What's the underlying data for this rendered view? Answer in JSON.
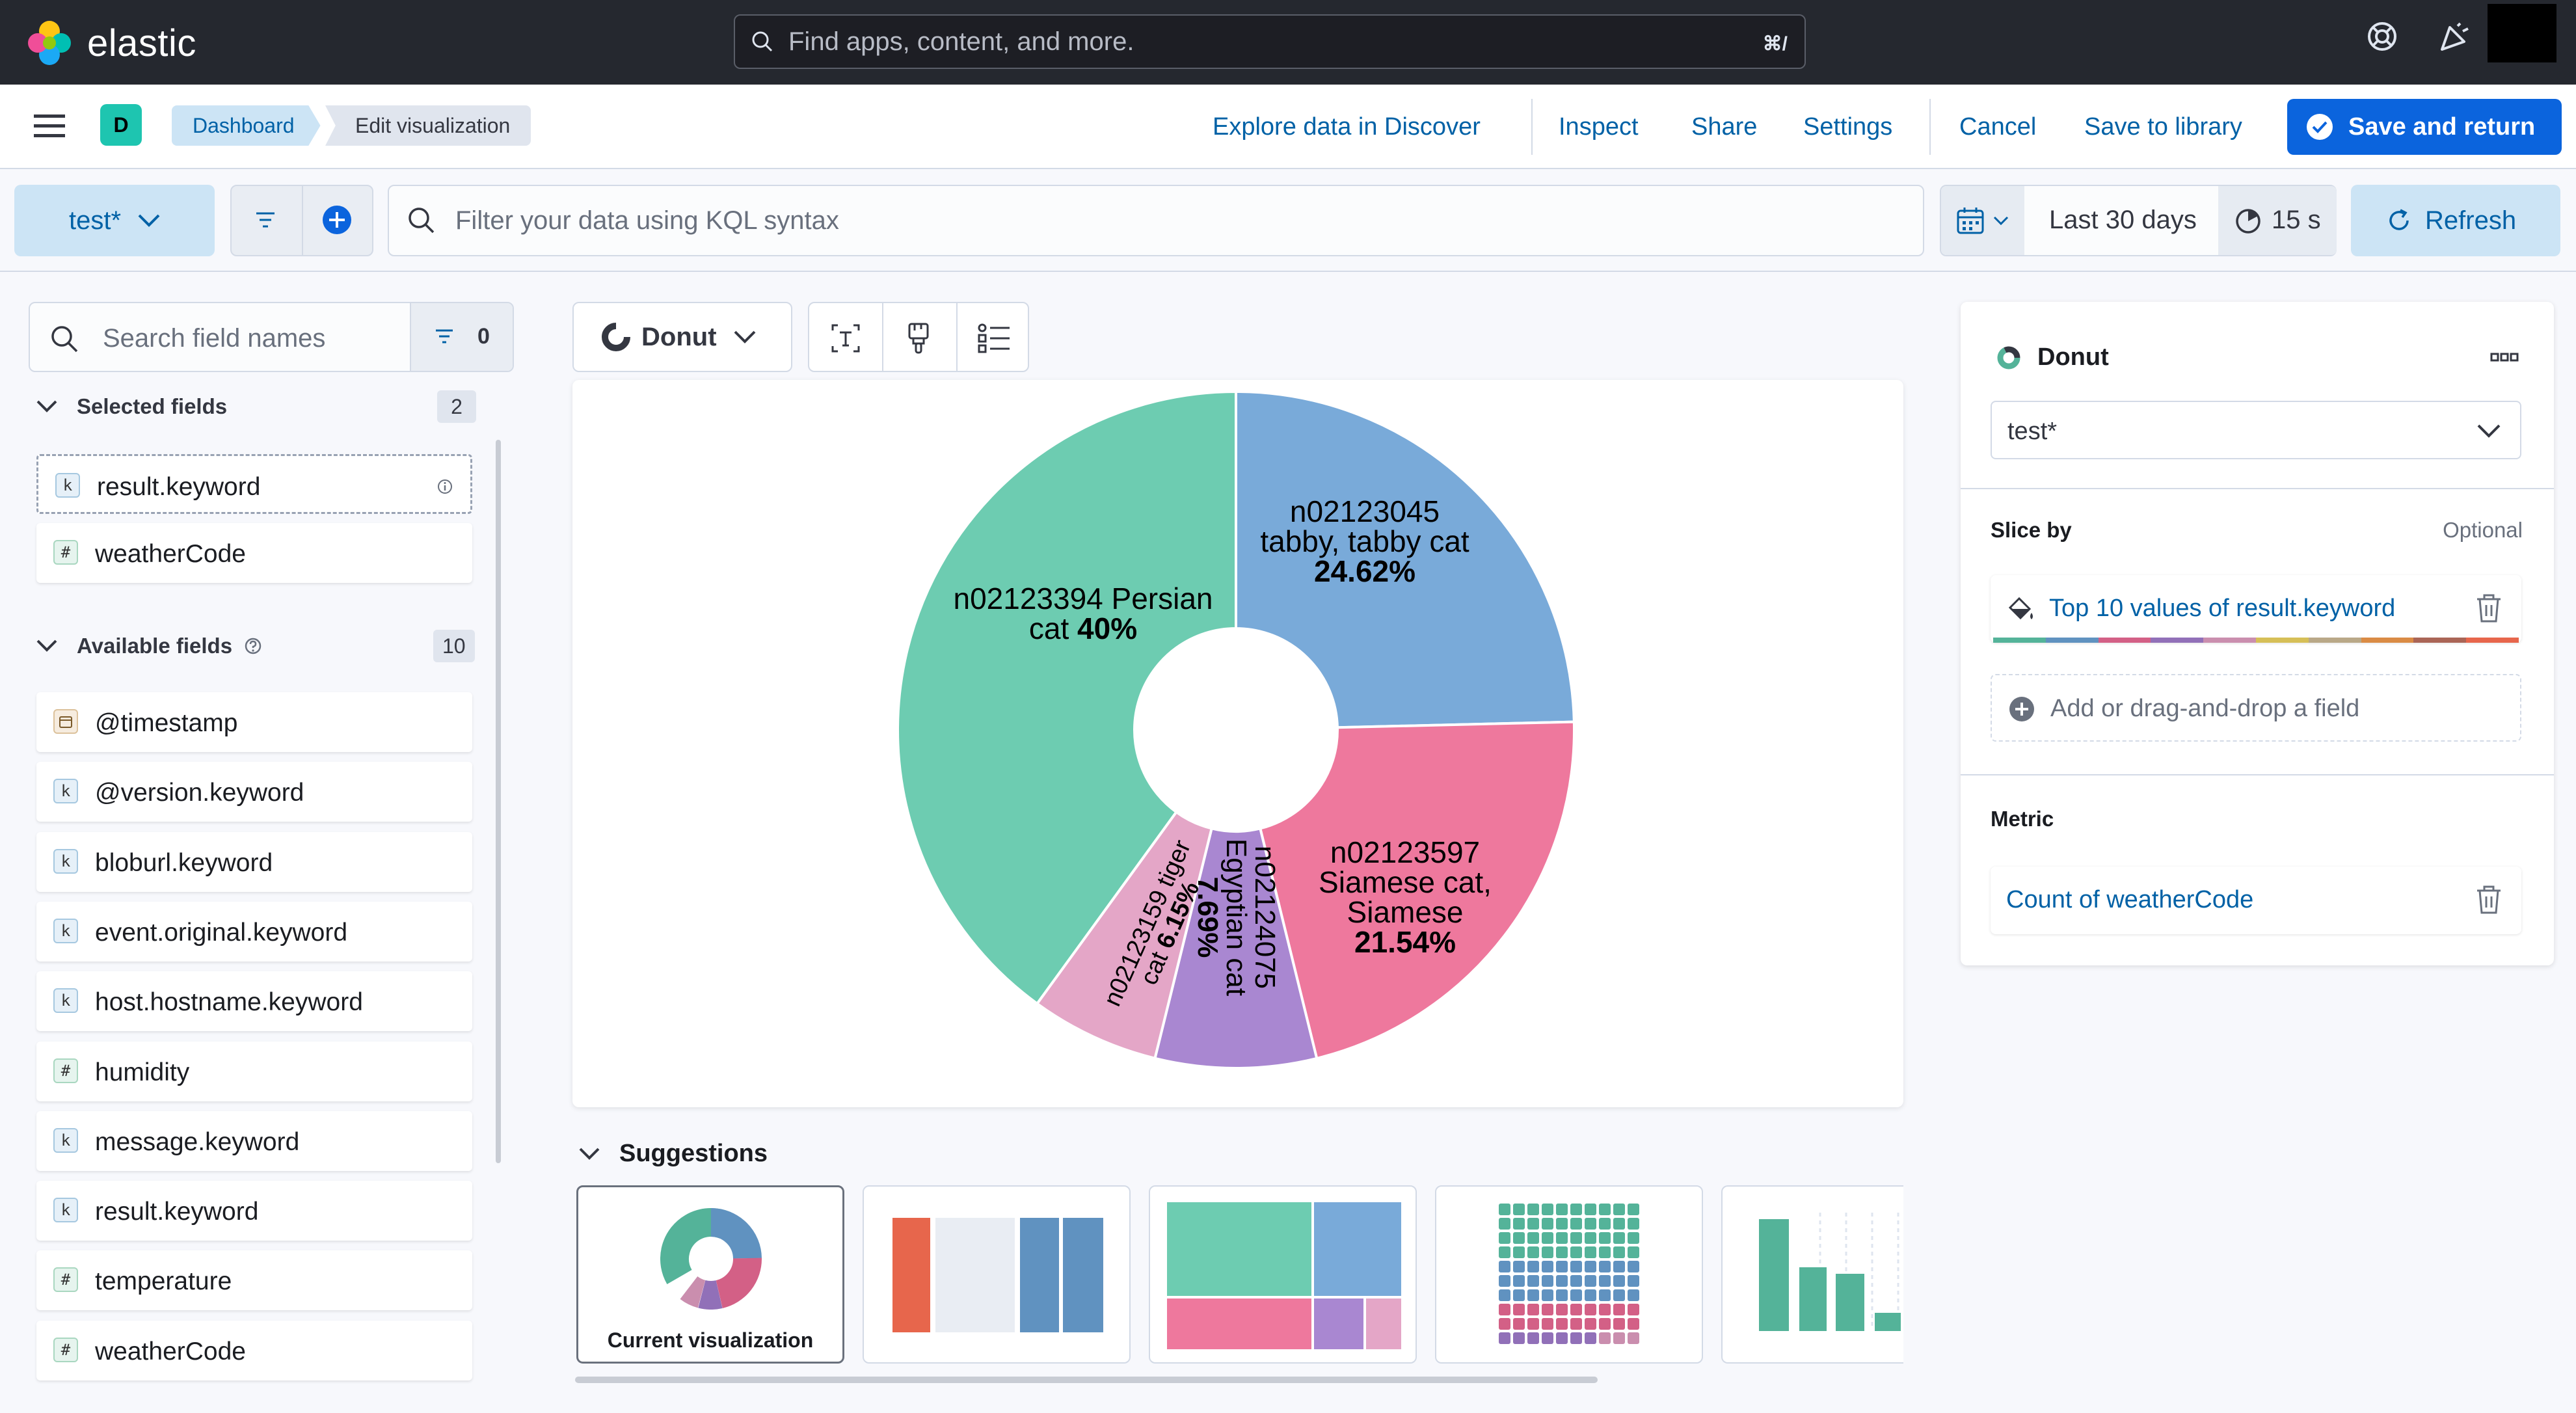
{
  "header": {
    "brand": "elastic",
    "search_placeholder": "Find apps, content, and more.",
    "search_shortcut": "⌘/"
  },
  "subheader": {
    "space_initial": "D",
    "breadcrumbs": [
      "Dashboard",
      "Edit visualization"
    ],
    "actions": {
      "explore": "Explore data in Discover",
      "inspect": "Inspect",
      "share": "Share",
      "settings": "Settings",
      "cancel": "Cancel",
      "save_library": "Save to library",
      "save_return": "Save and return"
    }
  },
  "querybar": {
    "dataview": "test*",
    "kql_placeholder": "Filter your data using KQL syntax",
    "date_range": "Last 30 days",
    "refresh_interval": "15 s",
    "refresh": "Refresh"
  },
  "fields": {
    "search_placeholder": "Search field names",
    "filter_count": "0",
    "selected_title": "Selected fields",
    "selected_count": "2",
    "selected": [
      {
        "type": "k",
        "name": "result.keyword"
      },
      {
        "type": "#",
        "name": "weatherCode"
      }
    ],
    "available_title": "Available fields",
    "available_count": "10",
    "available": [
      {
        "type": "date",
        "name": "@timestamp"
      },
      {
        "type": "k",
        "name": "@version.keyword"
      },
      {
        "type": "k",
        "name": "bloburl.keyword"
      },
      {
        "type": "k",
        "name": "event.original.keyword"
      },
      {
        "type": "k",
        "name": "host.hostname.keyword"
      },
      {
        "type": "#",
        "name": "humidity"
      },
      {
        "type": "k",
        "name": "message.keyword"
      },
      {
        "type": "k",
        "name": "result.keyword"
      },
      {
        "type": "#",
        "name": "temperature"
      },
      {
        "type": "#",
        "name": "weatherCode"
      }
    ]
  },
  "workspace": {
    "chart_type": "Donut"
  },
  "chart_data": {
    "type": "pie",
    "donut": true,
    "slices": [
      {
        "label_lines": [
          "n02123045",
          "tabby, tabby cat"
        ],
        "pct_label": "24.62%",
        "value": 24.62,
        "color": "#79aad9"
      },
      {
        "label_lines": [
          "n02123597",
          "Siamese cat,",
          "Siamese"
        ],
        "pct_label": "21.54%",
        "value": 21.54,
        "color": "#ee789d"
      },
      {
        "label_lines": [
          "n02124075",
          "Egyptian cat"
        ],
        "pct_label": "7.69%",
        "value": 7.69,
        "color": "#a987d1"
      },
      {
        "label_lines": [
          "n02123159 tiger",
          "cat"
        ],
        "pct_label": "6.15%",
        "value": 6.15,
        "color": "#e4a6c7"
      },
      {
        "label_lines": [
          "n02123394 Persian",
          "cat"
        ],
        "pct_label": "40%",
        "value": 40.0,
        "color": "#6dccb1"
      }
    ]
  },
  "suggestions": {
    "title": "Suggestions",
    "current_label": "Current visualization"
  },
  "config": {
    "title": "Donut",
    "dataview": "test*",
    "slice_by_label": "Slice by",
    "optional": "Optional",
    "slice_dimension": "Top 10 values of result.keyword",
    "add_field": "Add or drag-and-drop a field",
    "metric_label": "Metric",
    "metric_dimension": "Count of weatherCode",
    "palette": [
      "#54b399",
      "#6092c0",
      "#d36086",
      "#9170b8",
      "#ca8eae",
      "#d6bf57",
      "#b9a888",
      "#da8b45",
      "#aa6556",
      "#e7664c"
    ]
  }
}
